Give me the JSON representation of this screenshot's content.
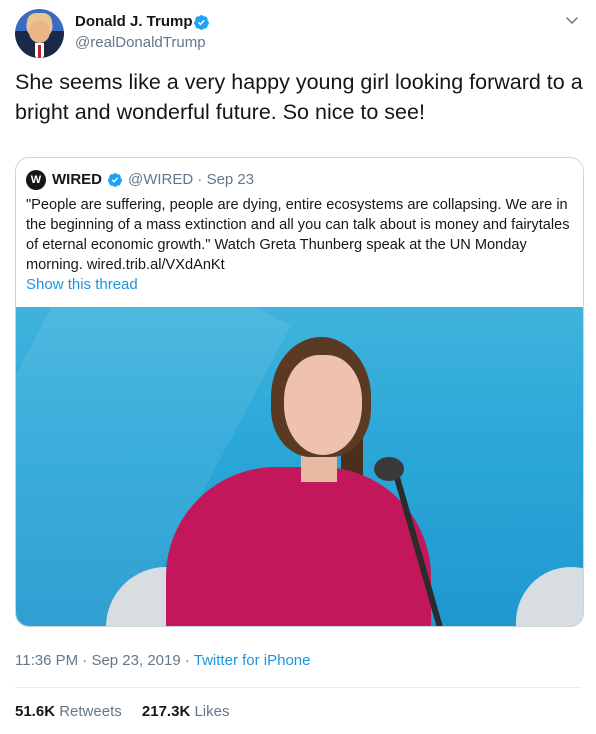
{
  "author": {
    "display_name": "Donald J. Trump",
    "handle": "@realDonaldTrump",
    "verified_icon": "verified-badge-icon",
    "avatar": "profile-photo"
  },
  "tweet": {
    "text": "She seems like a very happy young girl looking forward to a bright and wonderful future. So nice to see!"
  },
  "quoted": {
    "logo_letter": "W",
    "name": "WIRED",
    "handle": "@WIRED",
    "separator": "·",
    "date": "Sep 23",
    "text": "\"People are suffering, people are dying, entire ecosystems are collapsing. We are in the beginning of a mass extinction and all you can talk about is money and fairytales of eternal economic growth.\" Watch Greta Thunberg speak at the UN Monday morning. wired.trib.al/VXdAnKt",
    "thread_link": "Show this thread",
    "media": "video-still"
  },
  "meta": {
    "time": "11:36 PM",
    "sep1": "·",
    "date": "Sep 23, 2019",
    "sep2": "·",
    "source": "Twitter for iPhone"
  },
  "stats": {
    "retweets_count": "51.6K",
    "retweets_label": "Retweets",
    "likes_count": "217.3K",
    "likes_label": "Likes"
  },
  "colors": {
    "link": "#1b95e0",
    "secondary_text": "#657786",
    "primary_text": "#14171a",
    "verified": "#1da1f2",
    "border": "#ccd6dd"
  }
}
